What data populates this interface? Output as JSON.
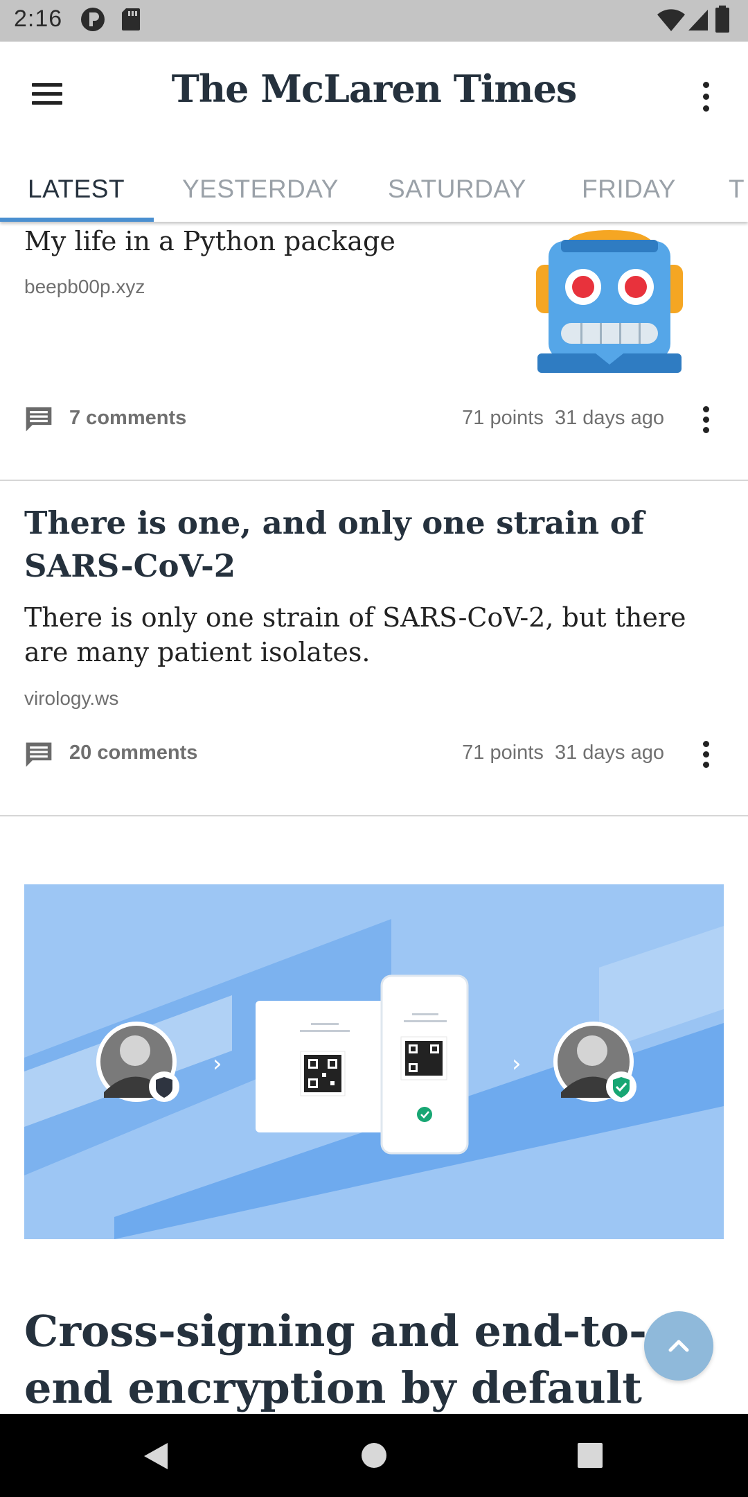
{
  "status_bar": {
    "time": "2:16"
  },
  "app_bar": {
    "title": "The McLaren Times",
    "tabs": [
      {
        "label": "LATEST"
      },
      {
        "label": "YESTERDAY"
      },
      {
        "label": "SATURDAY"
      },
      {
        "label": "FRIDAY"
      },
      {
        "label": "T"
      }
    ]
  },
  "stories": [
    {
      "title": "My life in a Python package",
      "domain": "beepb00p.xyz",
      "comments": "7 comments",
      "points": "71 points",
      "age": "31 days ago"
    },
    {
      "title": "There is one, and only one strain of SARS-CoV-2",
      "summary": "There is only one strain of SARS-CoV-2, but there are many patient isolates.",
      "domain": "virology.ws",
      "comments": "20 comments",
      "points": "71 points",
      "age": "31 days ago"
    },
    {
      "title": "Cross-signing and end-to-end encryption by default"
    }
  ],
  "colors": {
    "accent": "#4a8fd0",
    "title_text": "#25313d",
    "fab": "#8fb9da",
    "banner_bg": "#9dc6f4"
  },
  "icons": [
    "menu-icon",
    "more-vert-icon",
    "comment-icon",
    "robot-icon",
    "chevron-up-icon",
    "back-icon",
    "home-icon",
    "recents-icon"
  ]
}
